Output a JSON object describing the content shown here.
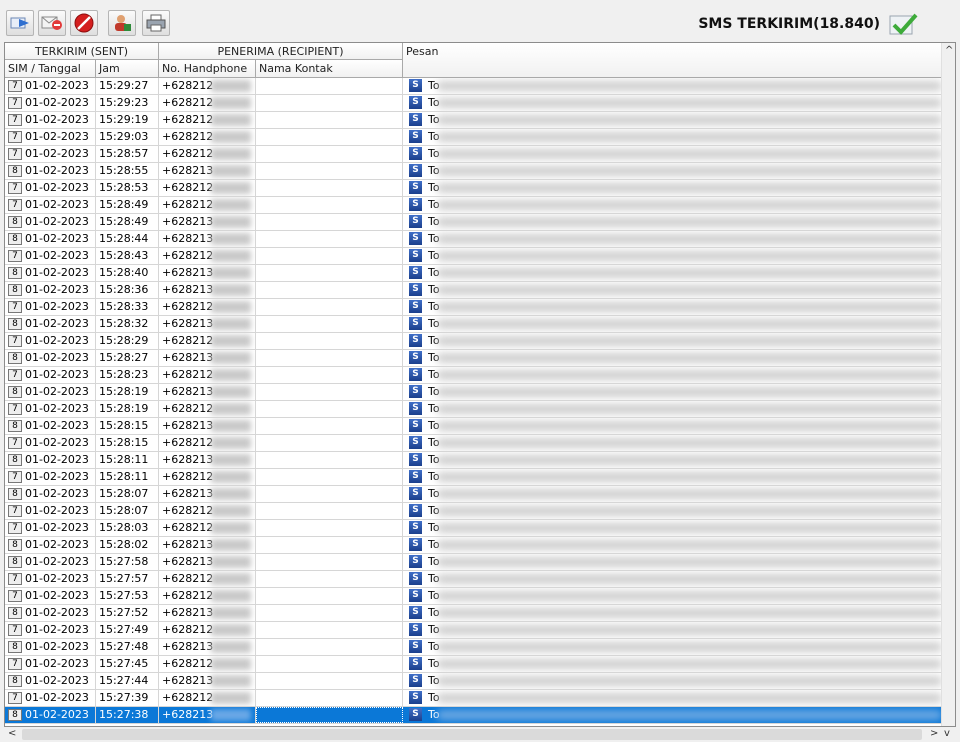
{
  "toolbar": {
    "buttons": [
      {
        "name": "forward-icon"
      },
      {
        "name": "delete-mail-icon"
      },
      {
        "name": "stop-icon"
      },
      {
        "name": "contacts-icon"
      },
      {
        "name": "print-icon"
      }
    ],
    "title": "SMS TERKIRIM(18.840)",
    "check_icon": "check-icon"
  },
  "grid": {
    "group_headers": {
      "sent": "TERKIRIM (SENT)",
      "recipient": "PENERIMA (RECIPIENT)",
      "message": "Pesan"
    },
    "columns": {
      "sim_date": "SIM / Tanggal",
      "time": "Jam",
      "phone": "No. Handphone",
      "contact": "Nama Kontak"
    },
    "rows": [
      {
        "sim": "7",
        "date": "01-02-2023",
        "time": "15:29:27",
        "phone": "+628212",
        "msg": "To"
      },
      {
        "sim": "7",
        "date": "01-02-2023",
        "time": "15:29:23",
        "phone": "+628212",
        "msg": "To"
      },
      {
        "sim": "7",
        "date": "01-02-2023",
        "time": "15:29:19",
        "phone": "+628212",
        "msg": "To"
      },
      {
        "sim": "7",
        "date": "01-02-2023",
        "time": "15:29:03",
        "phone": "+628212",
        "msg": "To"
      },
      {
        "sim": "7",
        "date": "01-02-2023",
        "time": "15:28:57",
        "phone": "+628212",
        "msg": "To"
      },
      {
        "sim": "8",
        "date": "01-02-2023",
        "time": "15:28:55",
        "phone": "+628213",
        "msg": "To"
      },
      {
        "sim": "7",
        "date": "01-02-2023",
        "time": "15:28:53",
        "phone": "+628212",
        "msg": "To"
      },
      {
        "sim": "7",
        "date": "01-02-2023",
        "time": "15:28:49",
        "phone": "+628212",
        "msg": "To"
      },
      {
        "sim": "8",
        "date": "01-02-2023",
        "time": "15:28:49",
        "phone": "+628213",
        "msg": "To"
      },
      {
        "sim": "8",
        "date": "01-02-2023",
        "time": "15:28:44",
        "phone": "+628213",
        "msg": "To"
      },
      {
        "sim": "7",
        "date": "01-02-2023",
        "time": "15:28:43",
        "phone": "+628212",
        "msg": "To"
      },
      {
        "sim": "8",
        "date": "01-02-2023",
        "time": "15:28:40",
        "phone": "+628213",
        "msg": "To"
      },
      {
        "sim": "8",
        "date": "01-02-2023",
        "time": "15:28:36",
        "phone": "+628213",
        "msg": "To"
      },
      {
        "sim": "7",
        "date": "01-02-2023",
        "time": "15:28:33",
        "phone": "+628212",
        "msg": "To"
      },
      {
        "sim": "8",
        "date": "01-02-2023",
        "time": "15:28:32",
        "phone": "+628213",
        "msg": "To"
      },
      {
        "sim": "7",
        "date": "01-02-2023",
        "time": "15:28:29",
        "phone": "+628212",
        "msg": "To"
      },
      {
        "sim": "8",
        "date": "01-02-2023",
        "time": "15:28:27",
        "phone": "+628213",
        "msg": "To"
      },
      {
        "sim": "7",
        "date": "01-02-2023",
        "time": "15:28:23",
        "phone": "+628212",
        "msg": "To"
      },
      {
        "sim": "8",
        "date": "01-02-2023",
        "time": "15:28:19",
        "phone": "+628213",
        "msg": "To"
      },
      {
        "sim": "7",
        "date": "01-02-2023",
        "time": "15:28:19",
        "phone": "+628212",
        "msg": "To"
      },
      {
        "sim": "8",
        "date": "01-02-2023",
        "time": "15:28:15",
        "phone": "+628213",
        "msg": "To"
      },
      {
        "sim": "7",
        "date": "01-02-2023",
        "time": "15:28:15",
        "phone": "+628212",
        "msg": "To"
      },
      {
        "sim": "8",
        "date": "01-02-2023",
        "time": "15:28:11",
        "phone": "+628213",
        "msg": "To"
      },
      {
        "sim": "7",
        "date": "01-02-2023",
        "time": "15:28:11",
        "phone": "+628212",
        "msg": "To"
      },
      {
        "sim": "8",
        "date": "01-02-2023",
        "time": "15:28:07",
        "phone": "+628213",
        "msg": "To"
      },
      {
        "sim": "7",
        "date": "01-02-2023",
        "time": "15:28:07",
        "phone": "+628212",
        "msg": "To"
      },
      {
        "sim": "7",
        "date": "01-02-2023",
        "time": "15:28:03",
        "phone": "+628212",
        "msg": "To"
      },
      {
        "sim": "8",
        "date": "01-02-2023",
        "time": "15:28:02",
        "phone": "+628213",
        "msg": "To"
      },
      {
        "sim": "8",
        "date": "01-02-2023",
        "time": "15:27:58",
        "phone": "+628213",
        "msg": "To"
      },
      {
        "sim": "7",
        "date": "01-02-2023",
        "time": "15:27:57",
        "phone": "+628212",
        "msg": "To"
      },
      {
        "sim": "7",
        "date": "01-02-2023",
        "time": "15:27:53",
        "phone": "+628212",
        "msg": "To"
      },
      {
        "sim": "8",
        "date": "01-02-2023",
        "time": "15:27:52",
        "phone": "+628213",
        "msg": "To"
      },
      {
        "sim": "7",
        "date": "01-02-2023",
        "time": "15:27:49",
        "phone": "+628212",
        "msg": "To"
      },
      {
        "sim": "8",
        "date": "01-02-2023",
        "time": "15:27:48",
        "phone": "+628213",
        "msg": "To"
      },
      {
        "sim": "7",
        "date": "01-02-2023",
        "time": "15:27:45",
        "phone": "+628212",
        "msg": "To"
      },
      {
        "sim": "8",
        "date": "01-02-2023",
        "time": "15:27:44",
        "phone": "+628213",
        "msg": "To"
      },
      {
        "sim": "7",
        "date": "01-02-2023",
        "time": "15:27:39",
        "phone": "+628212",
        "msg": "To"
      },
      {
        "sim": "8",
        "date": "01-02-2023",
        "time": "15:27:38",
        "phone": "+628213",
        "msg": "To",
        "selected": true
      }
    ],
    "message_type_icon": "S"
  },
  "colors": {
    "selection": "#0b78d7",
    "accent_green": "#3dab3a"
  }
}
